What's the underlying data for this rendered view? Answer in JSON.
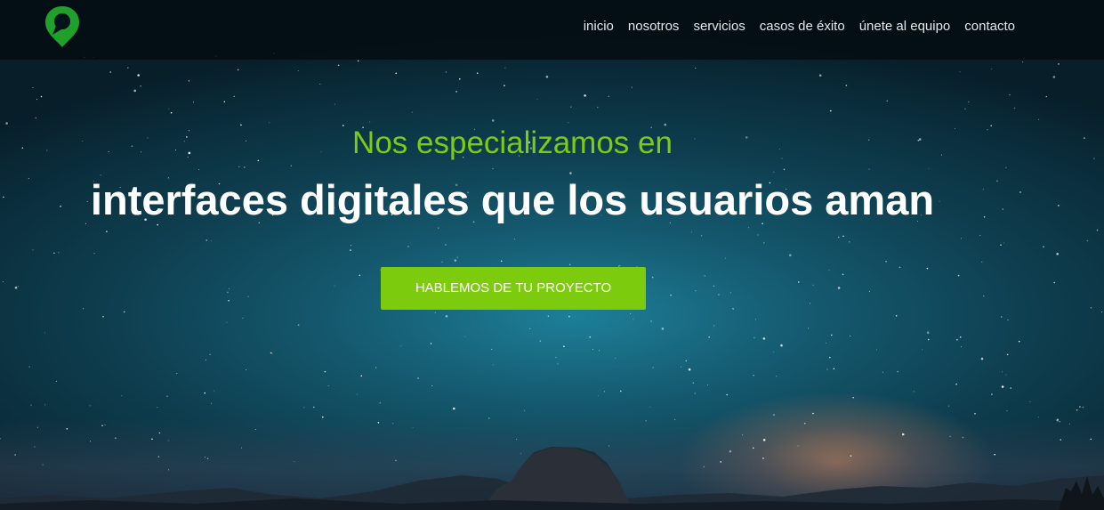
{
  "header": {
    "logo_icon": "map-pin-icon",
    "nav": [
      {
        "label": "inicio"
      },
      {
        "label": "nosotros"
      },
      {
        "label": "servicios"
      },
      {
        "label": "casos de éxito"
      },
      {
        "label": "únete al equipo"
      },
      {
        "label": "contacto"
      }
    ]
  },
  "hero": {
    "subtitle": "Nos especializamos en",
    "title": "interfaces digitales que los usuarios aman",
    "cta_label": "HABLEMOS DE TU PROYECTO"
  },
  "colors": {
    "accent": "#7ccc0d",
    "logo": "#1fa02a",
    "header_bg": "#030e12",
    "title_text": "#ffffff"
  }
}
